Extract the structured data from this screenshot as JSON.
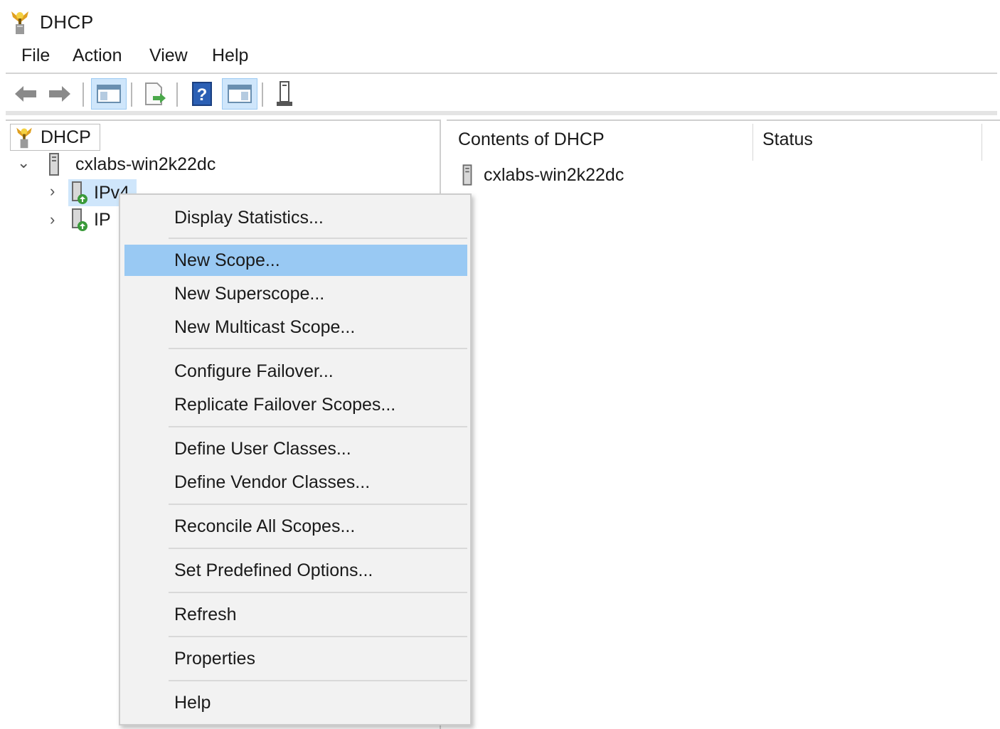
{
  "window": {
    "title": "DHCP"
  },
  "menubar": {
    "items": [
      "File",
      "Action",
      "View",
      "Help"
    ]
  },
  "toolbar": {
    "buttons": [
      "back-icon",
      "forward-icon",
      "show-hide-console-tree-icon",
      "export-list-icon",
      "help-icon",
      "show-hide-action-pane-icon",
      "server-icon"
    ]
  },
  "tree": {
    "root": "DHCP",
    "server": "cxlabs-win2k22dc",
    "ipv4": "IPv4",
    "ipv6_partial": "IP"
  },
  "list": {
    "headers": [
      "Contents of DHCP",
      "Status"
    ],
    "rows": [
      {
        "name": "cxlabs-win2k22dc",
        "status": ""
      }
    ]
  },
  "context_menu": {
    "items": [
      "Display Statistics...",
      "New Scope...",
      "New Superscope...",
      "New Multicast Scope...",
      "Configure Failover...",
      "Replicate Failover Scopes...",
      "Define User Classes...",
      "Define Vendor Classes...",
      "Reconcile All Scopes...",
      "Set Predefined Options...",
      "Refresh",
      "Properties",
      "Help"
    ],
    "highlighted": "New Scope..."
  },
  "colors": {
    "highlight": "#99c9f3",
    "selection": "#cfe6fb"
  }
}
